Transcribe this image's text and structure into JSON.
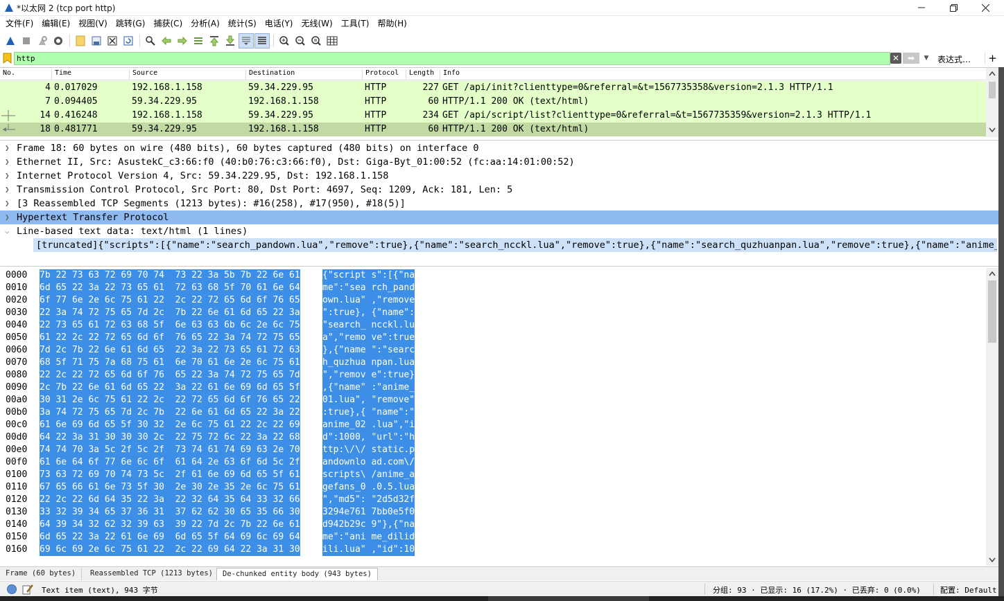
{
  "window": {
    "title": "*以太网 2 (tcp port http)",
    "minimize_icon": "minimize-glyph",
    "maximize_icon": "restore-glyph",
    "close_icon": "close-glyph"
  },
  "menubar": {
    "items": [
      "文件(F)",
      "编辑(E)",
      "视图(V)",
      "跳转(G)",
      "捕获(C)",
      "分析(A)",
      "统计(S)",
      "电话(Y)",
      "无线(W)",
      "工具(T)",
      "帮助(H)"
    ]
  },
  "toolbar": {
    "icons": [
      "shark-fin-start",
      "stop-square",
      "restart-fin",
      "options-gear",
      "open-folder",
      "save-file",
      "close-file",
      "reload",
      "find-magnifier",
      "go-back-arrow",
      "go-forward-arrow",
      "go-to-packet",
      "go-first",
      "go-last",
      "autoscroll",
      "colorize",
      "zoom-in",
      "zoom-out",
      "normal-size",
      "resize-columns"
    ]
  },
  "filter": {
    "value": "http",
    "expression_label": "表达式…",
    "add_label": "+",
    "background": "#afffaf"
  },
  "packet_list": {
    "columns": [
      "No.",
      "Time",
      "Source",
      "Destination",
      "Protocol",
      "Length",
      "Info"
    ],
    "rows": [
      {
        "no": "4",
        "time": "0.017029",
        "source": "192.168.1.158",
        "destination": "59.34.229.95",
        "protocol": "HTTP",
        "length": "227",
        "info": "GET /api/init?clienttype=0&referral=&t=1567735358&version=2.1.3 HTTP/1.1"
      },
      {
        "no": "7",
        "time": "0.094405",
        "source": "59.34.229.95",
        "destination": "192.168.1.158",
        "protocol": "HTTP",
        "length": "60",
        "info": "HTTP/1.1 200 OK  (text/html)"
      },
      {
        "no": "14",
        "time": "0.416248",
        "source": "192.168.1.158",
        "destination": "59.34.229.95",
        "protocol": "HTTP",
        "length": "234",
        "info": "GET /api/script/list?clienttype=0&referral=&t=1567735359&version=2.1.3 HTTP/1.1"
      },
      {
        "no": "18",
        "time": "0.481771",
        "source": "59.34.229.95",
        "destination": "192.168.1.158",
        "protocol": "HTTP",
        "length": "60",
        "info": "HTTP/1.1 200 OK  (text/html)"
      }
    ],
    "row_color": "#e4ffc7",
    "selected_row_color": "#c2d9a3"
  },
  "details": {
    "lines": [
      "Frame 18: 60 bytes on wire (480 bits), 60 bytes captured (480 bits) on interface 0",
      "Ethernet II, Src: AsustekC_c3:66:f0 (40:b0:76:c3:66:f0), Dst: Giga-Byt_01:00:52 (fc:aa:14:01:00:52)",
      "Internet Protocol Version 4, Src: 59.34.229.95, Dst: 192.168.1.158",
      "Transmission Control Protocol, Src Port: 80, Dst Port: 4697, Seq: 1209, Ack: 181, Len: 5",
      "[3 Reassembled TCP Segments (1213 bytes): #16(258), #17(950), #18(5)]",
      "Hypertext Transfer Protocol",
      "Line-based text data: text/html (1 lines)"
    ],
    "body_line": "[truncated]{\"scripts\":[{\"name\":\"search_pandown.lua\",\"remove\":true},{\"name\":\"search_ncckl.lua\",\"remove\":true},{\"name\":\"search_quzhuanpan.lua\",\"remove\":true},{\"name\":\"anime_…"
  },
  "bytes": {
    "offsets": [
      "0000",
      "0010",
      "0020",
      "0030",
      "0040",
      "0050",
      "0060",
      "0070",
      "0080",
      "0090",
      "00a0",
      "00b0",
      "00c0",
      "00d0",
      "00e0",
      "00f0",
      "0100",
      "0110",
      "0120",
      "0130",
      "0140",
      "0150",
      "0160"
    ],
    "hex": [
      "7b 22 73 63 72 69 70 74  73 22 3a 5b 7b 22 6e 61",
      "6d 65 22 3a 22 73 65 61  72 63 68 5f 70 61 6e 64",
      "6f 77 6e 2e 6c 75 61 22  2c 22 72 65 6d 6f 76 65",
      "22 3a 74 72 75 65 7d 2c  7b 22 6e 61 6d 65 22 3a",
      "22 73 65 61 72 63 68 5f  6e 63 63 6b 6c 2e 6c 75",
      "61 22 2c 22 72 65 6d 6f  76 65 22 3a 74 72 75 65",
      "7d 2c 7b 22 6e 61 6d 65  22 3a 22 73 65 61 72 63",
      "68 5f 71 75 7a 68 75 61  6e 70 61 6e 2e 6c 75 61",
      "22 2c 22 72 65 6d 6f 76  65 22 3a 74 72 75 65 7d",
      "2c 7b 22 6e 61 6d 65 22  3a 22 61 6e 69 6d 65 5f",
      "30 31 2e 6c 75 61 22 2c  22 72 65 6d 6f 76 65 22",
      "3a 74 72 75 65 7d 2c 7b  22 6e 61 6d 65 22 3a 22",
      "61 6e 69 6d 65 5f 30 32  2e 6c 75 61 22 2c 22 69",
      "64 22 3a 31 30 30 30 2c  22 75 72 6c 22 3a 22 68",
      "74 74 70 3a 5c 2f 5c 2f  73 74 61 74 69 63 2e 70",
      "61 6e 64 6f 77 6e 6c 6f  61 64 2e 63 6f 6d 5c 2f",
      "73 63 72 69 70 74 73 5c  2f 61 6e 69 6d 65 5f 61",
      "67 65 66 61 6e 73 5f 30  2e 30 2e 35 2e 6c 75 61",
      "22 2c 22 6d 64 35 22 3a  22 32 64 35 64 33 32 66",
      "33 32 39 34 65 37 36 31  37 62 62 30 65 35 66 30",
      "64 39 34 32 62 32 39 63  39 22 7d 2c 7b 22 6e 61",
      "6d 65 22 3a 22 61 6e 69  6d 65 5f 64 69 6c 69 64",
      "69 6c 69 2e 6c 75 61 22  2c 22 69 64 22 3a 31 30"
    ],
    "ascii": [
      "{\"script s\":[{\"na",
      "me\":\"sea rch_pand",
      "own.lua\" ,\"remove",
      "\":true}, {\"name\":",
      "\"search_ ncckl.lu",
      "a\",\"remo ve\":true",
      "},{\"name \":\"searc",
      "h_quzhua npan.lua",
      "\",\"remov e\":true}",
      ",{\"name\" :\"anime_",
      "01.lua\", \"remove\"",
      ":true},{ \"name\":\"",
      "anime_02 .lua\",\"i",
      "d\":1000, \"url\":\"h",
      "ttp:\\/\\/ static.p",
      "andownlo ad.com\\/",
      "scripts\\ /anime_a",
      "gefans_0 .0.5.lua",
      "\",\"md5\": \"2d5d32f",
      "3294e761 7bb0e5f0",
      "d942b29c 9\"},{\"na",
      "me\":\"ani me_dilid",
      "ili.lua\" ,\"id\":10"
    ],
    "selection_color": "#3c8ee6"
  },
  "byte_tabs": [
    "Frame (60 bytes)",
    "Reassembled TCP (1213 bytes)",
    "De-chunked entity body (943 bytes)"
  ],
  "status": {
    "left_text": "Text item (text), 943 字节",
    "packets_text": "分组: 93 · 已显示: 16 (17.2%) · 已丢弃: 0 (0.0%)",
    "profile_text": "配置: Default"
  }
}
